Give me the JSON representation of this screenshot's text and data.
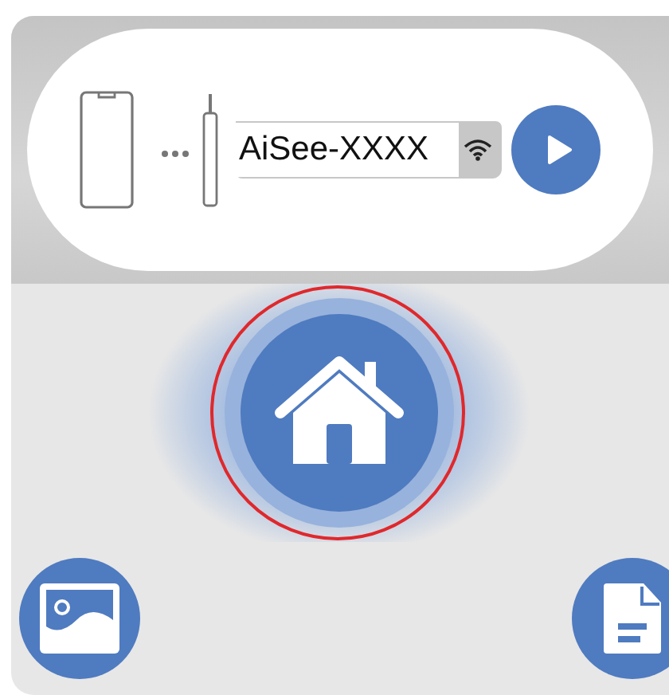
{
  "device_field": {
    "value": "AiSee-XXXX"
  },
  "home_button": {
    "selected": true
  }
}
